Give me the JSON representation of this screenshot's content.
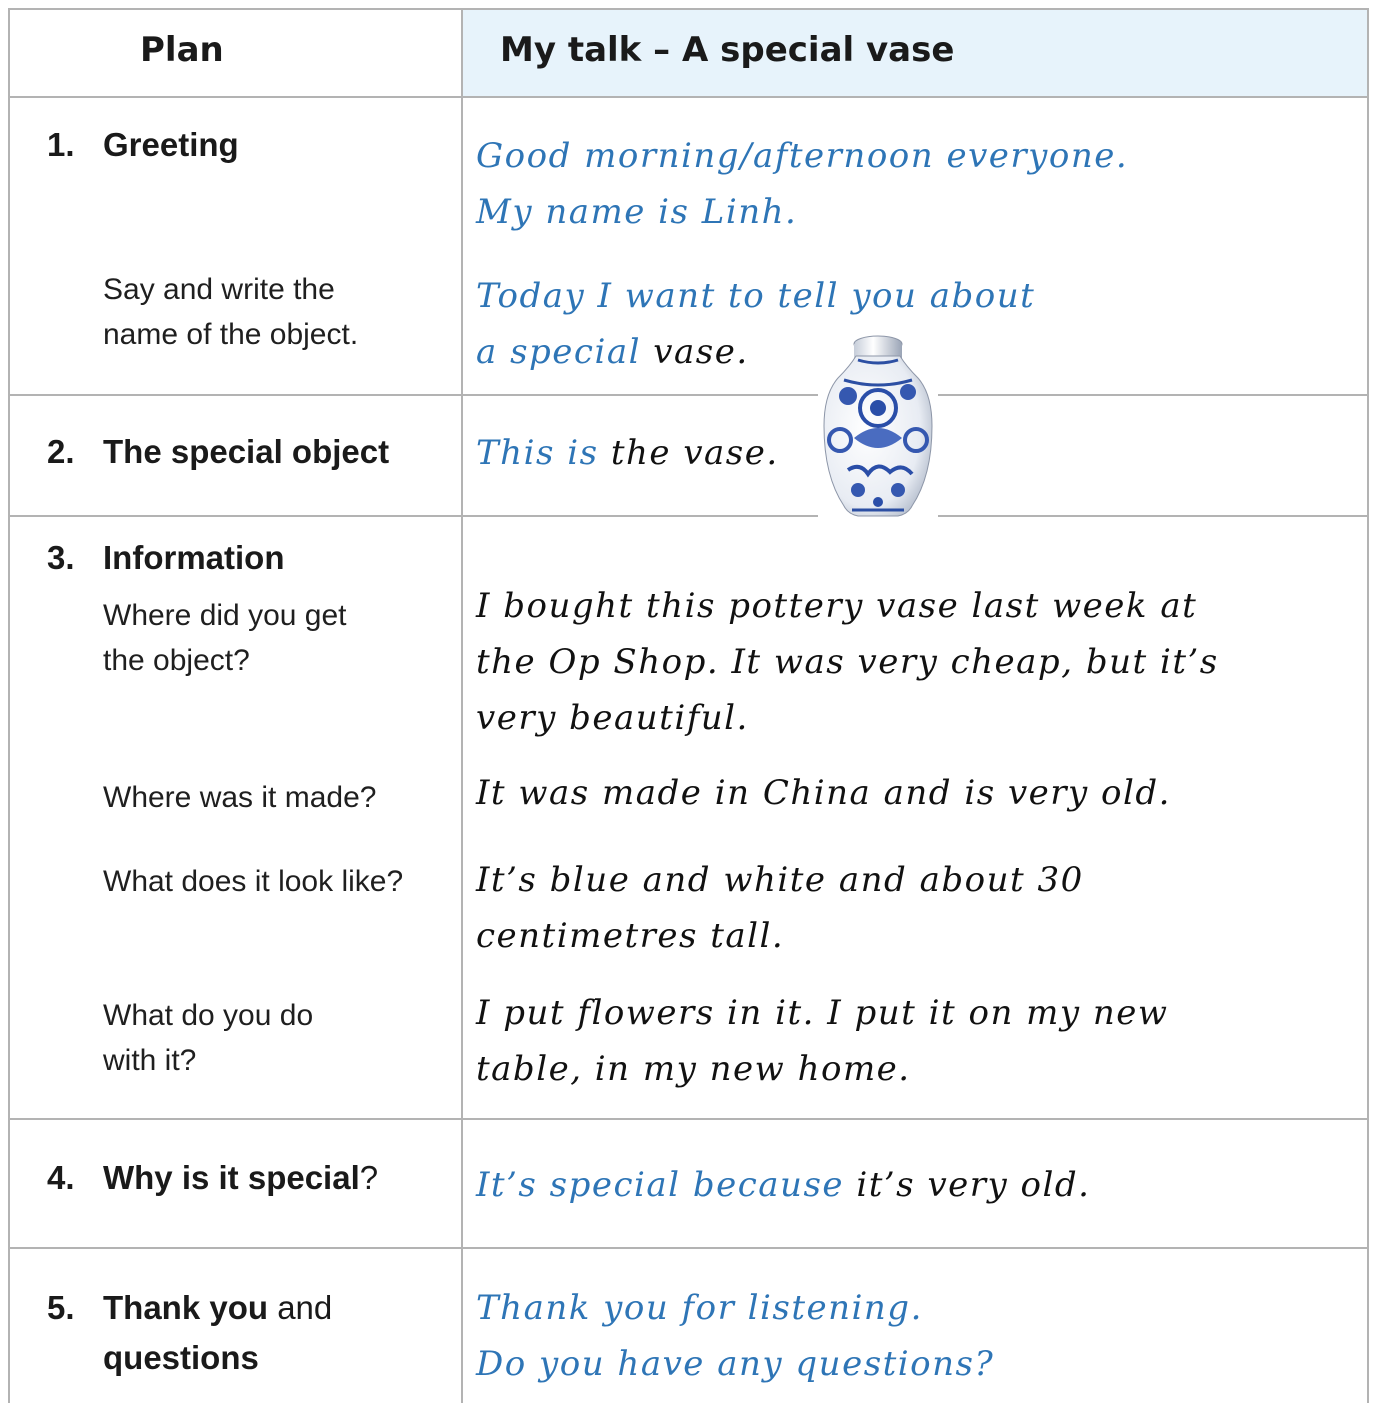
{
  "header": {
    "plan": "Plan",
    "talk_title": "My talk – A special vase"
  },
  "sections": [
    {
      "number": "1.",
      "label": "Greeting",
      "talk_lines": [
        "Good morning/afternoon everyone.",
        "My name is Linh."
      ],
      "prompt": "Say and write the name of the object.",
      "prompt_lines": [
        "Say and write the",
        "name of the object."
      ],
      "prompt_talk": {
        "line1": "Today I want to tell you about",
        "line2_blue": "a special",
        "line2_black": " vase."
      }
    },
    {
      "number": "2.",
      "label": "The special object",
      "talk_blue": "This is",
      "talk_black": " the vase.",
      "image": "blue-and-white-vase-photo"
    },
    {
      "number": "3.",
      "label": "Information",
      "items": [
        {
          "q_lines": [
            "Where did you get",
            "the object?"
          ],
          "a_lines": [
            "I bought this pottery vase last week at",
            "the Op Shop. It was very cheap, but it’s",
            "very beautiful."
          ]
        },
        {
          "q_lines": [
            "Where was it made?"
          ],
          "a_lines": [
            "It was made in China and is very old."
          ]
        },
        {
          "q_lines": [
            "What does it look like?"
          ],
          "a_lines": [
            "It’s blue and white and about 30",
            "centimetres tall."
          ]
        },
        {
          "q_lines": [
            "What do you do",
            "with it?"
          ],
          "a_lines": [
            "I put flowers in it. I put it on my new",
            "table, in my new home."
          ]
        }
      ]
    },
    {
      "number": "4.",
      "label_bold": "Why is it special",
      "label_rest": "?",
      "talk_blue": "It’s special because",
      "talk_black": " it’s very old."
    },
    {
      "number": "5.",
      "label_bold1": "Thank you",
      "label_norm": " and",
      "label_bold2": "questions",
      "talk_lines": [
        "Thank you for listening.",
        "Do you have any questions?"
      ]
    }
  ],
  "colors": {
    "blue_text": "#2e75b6",
    "header_bg": "#e7f3fb",
    "border": "#b3b3b3"
  }
}
